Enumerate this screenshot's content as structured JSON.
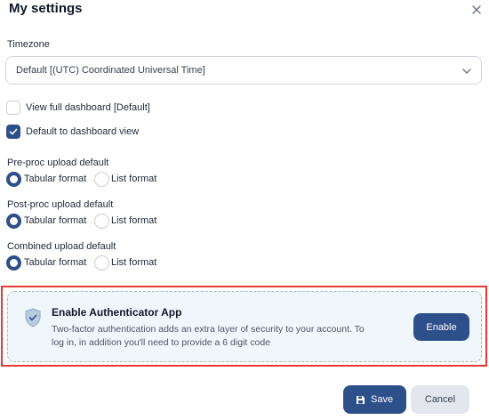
{
  "dialog": {
    "title": "My settings",
    "close_icon": "close-icon"
  },
  "timezone": {
    "label": "Timezone",
    "value": "Default [(UTC) Coordinated Universal Time]"
  },
  "view_options": [
    {
      "label": "View full dashboard [Default]",
      "checked": false
    },
    {
      "label": "Default to dashboard view",
      "checked": true
    }
  ],
  "upload_defaults": [
    {
      "label": "Pre-proc upload default",
      "options": [
        "Tabular format",
        "List format"
      ],
      "selected": "Tabular format"
    },
    {
      "label": "Post-proc upload default",
      "options": [
        "Tabular format",
        "List format"
      ],
      "selected": "Tabular format"
    },
    {
      "label": "Combined upload default",
      "options": [
        "Tabular format",
        "List format"
      ],
      "selected": "Tabular format"
    }
  ],
  "authenticator": {
    "icon": "shield-check-icon",
    "title": "Enable Authenticator App",
    "description": "Two-factor authentication adds an extra layer of security to your account. To log in, in addition you'll need to provide a 6 digit code",
    "button_label": "Enable"
  },
  "footer": {
    "save_label": "Save",
    "cancel_label": "Cancel"
  },
  "colors": {
    "primary": "#2d4f8a",
    "highlight_border": "#e53935",
    "card_bg": "#f0f7fc"
  }
}
